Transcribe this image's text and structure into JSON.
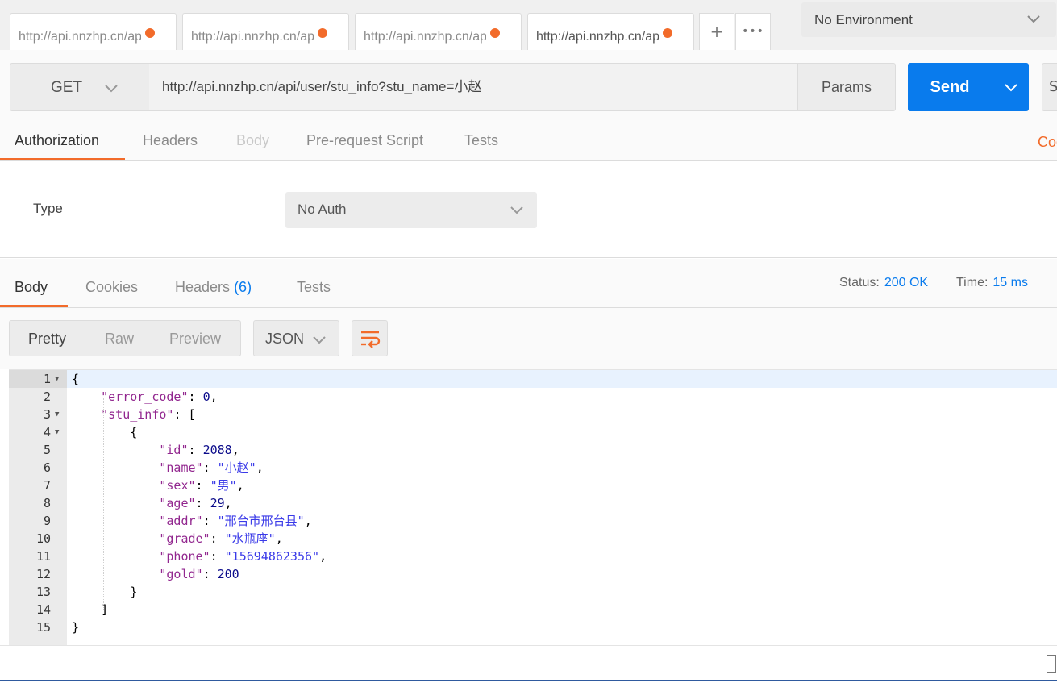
{
  "tabs": [
    {
      "title": "http://api.nnzhp.cn/api/user/stu_info?stu_name=小赵",
      "active": false
    },
    {
      "title": "http://api.nnzhp.cn/api/user/stu_info?stu_name=小赵",
      "active": false
    },
    {
      "title": "http://api.nnzhp.cn/api/user/stu_info?stu_name=小赵",
      "active": false
    },
    {
      "title": "http://api.nnzhp.cn/api/user/stu_info?stu_name=小赵",
      "active": true
    }
  ],
  "tab_controls": {
    "add": "+",
    "more": "•••"
  },
  "environment": {
    "selected": "No Environment"
  },
  "request": {
    "method": "GET",
    "url": "http://api.nnzhp.cn/api/user/stu_info?stu_name=小赵",
    "params_label": "Params",
    "send_label": "Send",
    "save_label": "S"
  },
  "request_tabs": {
    "authorization": "Authorization",
    "headers": "Headers",
    "body": "Body",
    "pre_request": "Pre-request Script",
    "tests": "Tests",
    "code": "Code"
  },
  "auth": {
    "type_label": "Type",
    "selected": "No Auth"
  },
  "response_tabs": {
    "body": "Body",
    "cookies": "Cookies",
    "headers": "Headers",
    "headers_count": "(6)",
    "tests": "Tests"
  },
  "status": {
    "status_label": "Status:",
    "status_value": "200 OK",
    "time_label": "Time:",
    "time_value": "15 ms"
  },
  "view_modes": {
    "pretty": "Pretty",
    "raw": "Raw",
    "preview": "Preview"
  },
  "format": {
    "selected": "JSON"
  },
  "code_lines": [
    {
      "n": "1",
      "fold": true
    },
    {
      "n": "2",
      "fold": false
    },
    {
      "n": "3",
      "fold": true
    },
    {
      "n": "4",
      "fold": true
    },
    {
      "n": "5",
      "fold": false
    },
    {
      "n": "6",
      "fold": false
    },
    {
      "n": "7",
      "fold": false
    },
    {
      "n": "8",
      "fold": false
    },
    {
      "n": "9",
      "fold": false
    },
    {
      "n": "10",
      "fold": false
    },
    {
      "n": "11",
      "fold": false
    },
    {
      "n": "12",
      "fold": false
    },
    {
      "n": "13",
      "fold": false
    },
    {
      "n": "14",
      "fold": false
    },
    {
      "n": "15",
      "fold": false
    }
  ],
  "response_json": {
    "k_error_code": "\"error_code\"",
    "v_error_code": "0",
    "k_stu_info": "\"stu_info\"",
    "k_id": "\"id\"",
    "v_id": "2088",
    "k_name": "\"name\"",
    "v_name": "\"小赵\"",
    "k_sex": "\"sex\"",
    "v_sex": "\"男\"",
    "k_age": "\"age\"",
    "v_age": "29",
    "k_addr": "\"addr\"",
    "v_addr": "\"邢台市邢台县\"",
    "k_grade": "\"grade\"",
    "v_grade": "\"水瓶座\"",
    "k_phone": "\"phone\"",
    "v_phone": "\"15694862356\"",
    "k_gold": "\"gold\"",
    "v_gold": "200"
  },
  "colors": {
    "accent": "#f26b2a",
    "primary": "#097bed",
    "json_key": "#92278f",
    "json_string": "#3a3ae8",
    "json_number": "#0a0a8a"
  }
}
